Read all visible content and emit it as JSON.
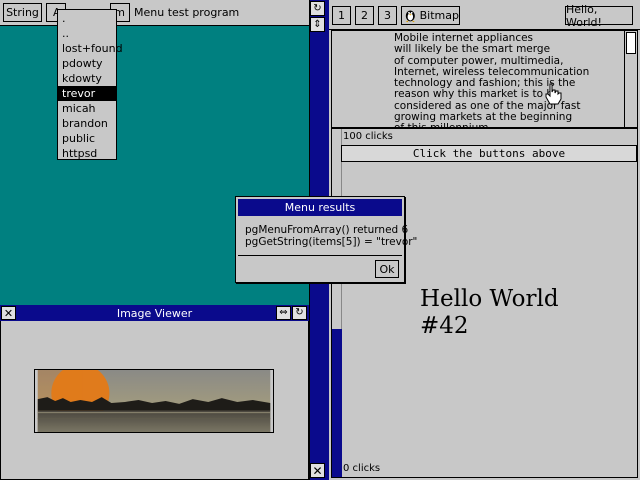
{
  "top_toolbar": {
    "string_button": "String",
    "a_button": "A",
    "m_button": "m",
    "title": "Menu test program"
  },
  "popup_menu": {
    "items": [
      ".",
      "..",
      "lost+found",
      "pdowty",
      "kdowty",
      "trevor",
      "micah",
      "brandon",
      "public",
      "httpsd"
    ],
    "selected_index": 5
  },
  "right_toolbar": {
    "buttons": [
      "1",
      "2",
      "3"
    ],
    "bitmap_label": "Bitmap",
    "hello_button": "Hello, World!"
  },
  "text_panel": {
    "lines": [
      "Mobile internet appliances",
      "will likely be the smart merge",
      "of computer power, multimedia,",
      "Internet, wireless telecommunication",
      "technology and fashion; this is the",
      "reason why this market is to be",
      "considered as one of the major fast",
      "growing markets at the beginning",
      "of this millennium."
    ]
  },
  "clicks_panel": {
    "top_count": "100 clicks",
    "header": "Click the buttons above",
    "hello_line1": "Hello World",
    "hello_line2": "#42",
    "bottom_count": "0 clicks"
  },
  "menu_results": {
    "title": "Menu results",
    "line1": "pgMenuFromArray() returned 6",
    "line2": "pgGetString(items[5]) = \"trevor\"",
    "ok_button": "Ok"
  },
  "image_viewer": {
    "title": "Image Viewer"
  },
  "colors": {
    "desktop_teal": "#008080",
    "titlebar_blue": "#0a0a8c",
    "panel_gray": "#c8c8c8"
  }
}
